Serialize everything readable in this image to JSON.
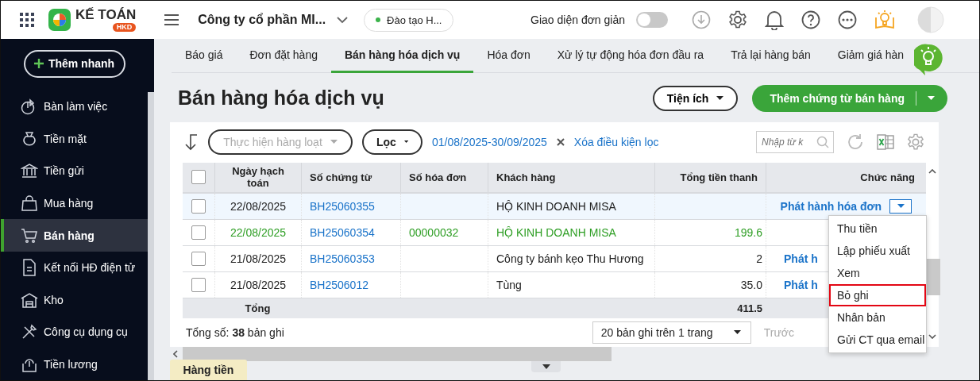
{
  "topbar": {
    "logo": {
      "name": "KẾ TOÁN",
      "badge": "HKD"
    },
    "company": "Công ty cổ phần MI...",
    "workspace": "Đào tạo H...",
    "simple_mode": {
      "label": "Giao diện đơn giản",
      "on": false
    }
  },
  "sidebar": {
    "quick_add": "Thêm nhanh",
    "items": [
      {
        "label": "Bàn làm việc",
        "selected": false
      },
      {
        "label": "Tiền mặt",
        "selected": false
      },
      {
        "label": "Tiền gửi",
        "selected": false
      },
      {
        "label": "Mua hàng",
        "selected": false
      },
      {
        "label": "Bán hàng",
        "selected": true
      },
      {
        "label": "Kết nối HĐ điện tử",
        "selected": false
      },
      {
        "label": "Kho",
        "selected": false
      },
      {
        "label": "Công cụ dụng cụ",
        "selected": false
      },
      {
        "label": "Tiền lương",
        "selected": false
      }
    ]
  },
  "tabs": [
    {
      "label": "Báo giá",
      "selected": false
    },
    {
      "label": "Đơn đặt hàng",
      "selected": false
    },
    {
      "label": "Bán hàng hóa dịch vụ",
      "selected": true
    },
    {
      "label": "Hóa đơn",
      "selected": false
    },
    {
      "label": "Xử lý tự động hóa đơn đầu ra",
      "selected": false
    },
    {
      "label": "Trả lại hàng bán",
      "selected": false
    },
    {
      "label": "Giảm giá hàn",
      "selected": false
    }
  ],
  "page_title": "Bán hàng hóa dịch vụ",
  "buttons": {
    "utilities": "Tiện ích",
    "primary": "Thêm chứng từ bán hàng"
  },
  "toolbar": {
    "bulk_action": {
      "label": "Thực hiện hàng loạt",
      "disabled": true
    },
    "filter": "Lọc",
    "date_range": "01/08/2025-30/09/2025",
    "clear_filter": "Xóa điều kiện lọc",
    "search": {
      "placeholder": "Nhập từ k"
    }
  },
  "table": {
    "columns": [
      "Ngày hạch toán",
      "Số chứng từ",
      "Số hóa đơn",
      "Khách hàng",
      "Tổng tiền thanh",
      "Chức năng"
    ],
    "header_checked": false,
    "rows": [
      {
        "selected": true,
        "issued": false,
        "checked": false,
        "date": "22/08/2025",
        "voucher": "BH25060355",
        "customer": "HỘ KINH DOANH MISA",
        "action": "Phát hành hóa đơn",
        "action_menu": true
      },
      {
        "selected": false,
        "issued": true,
        "checked": false,
        "date": "22/08/2025",
        "voucher": "BH25060354",
        "invoice": "00000032",
        "customer": "HỘ KINH DOANH MISA",
        "total": "199.6"
      },
      {
        "selected": false,
        "issued": false,
        "checked": false,
        "date": "21/08/2025",
        "voucher": "BH25060353",
        "customer": "Công ty bánh kẹo Thu Hương",
        "total": "2",
        "action": "Phát h"
      },
      {
        "selected": false,
        "issued": false,
        "checked": false,
        "date": "21/08/2025",
        "voucher": "BH2506012",
        "customer": "Tùng",
        "total": "35.0",
        "action": "Phát h"
      }
    ],
    "total_label": "Tổng",
    "total_amount": "411.5"
  },
  "footer": {
    "count": "Tổng số: **38** bản ghi",
    "page_size": "20 bản ghi trên 1 trang",
    "prev": {
      "label": "Trước",
      "disabled": true
    }
  },
  "menu": {
    "items": [
      {
        "label": "Thu tiền",
        "selected": false
      },
      {
        "label": "Lập phiếu xuất",
        "selected": false
      },
      {
        "label": "Xem",
        "selected": false
      },
      {
        "label": "Bỏ ghi",
        "selected": true
      },
      {
        "label": "Nhân bản",
        "selected": false
      },
      {
        "label": "Gửi CT qua email",
        "selected": false
      }
    ]
  },
  "bottom_tab": "Hàng tiền"
}
